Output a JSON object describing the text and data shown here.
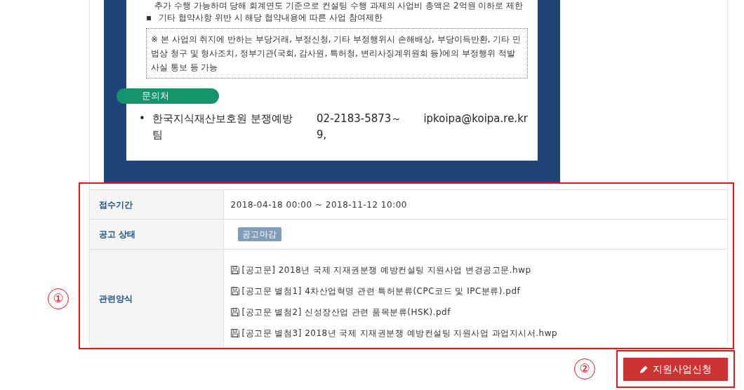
{
  "poster": {
    "items": [
      {
        "kind": "continuation",
        "text": "추가 수행 가능하며 당해 회계연도 기준으로 컨설팅 수행 과제의 사업비 총액은 2억원 이하로 제한"
      },
      {
        "kind": "bullet",
        "marker": "▪",
        "text": "기타 협약사항 위반 시 해당 협약내용에 따른 사업 참여제한"
      }
    ],
    "notice": "※ 본 사업의 취지에 반하는 부당거래, 부정신청, 기타 부정행위시 손해배상, 부당이득반환, 기타 민법상 청구 및 형사조치, 정부기관(국회, 감사원, 특허청, 변리사징계위원회 등)에의 부정행위 적발사실 통보 등 가능",
    "contact_heading": "문의처",
    "contact": {
      "marker": "•",
      "org": "한국지식재산보호원 분쟁예방팀",
      "phone": "02-2183-5873～9,",
      "email": "ipkoipa@koipa.re.kr"
    }
  },
  "table": {
    "annotation": "①",
    "rows": [
      {
        "label": "접수기간",
        "kind": "text",
        "value": "2018-04-18 00:00 ~ 2018-11-12 10:00"
      },
      {
        "label": "공고 상태",
        "kind": "badge",
        "value": "공고마감"
      },
      {
        "label": "관련양식",
        "kind": "files",
        "files": [
          "[공고문] 2018년 국제 지재권분쟁 예방컨설팅 지원사업 변경공고문.hwp",
          "[공고문 별첨1] 4차산업혁명 관련 특허분류(CPC코드 및 IPC분류).pdf",
          "[공고문 별첨2] 신성장산업 관련 품목분류(HSK).pdf",
          "[공고문 별첨3] 2018년 국제 지재권분쟁 예방컨설팅 지원사업 과업지시서.hwp"
        ]
      }
    ]
  },
  "apply_button": {
    "annotation": "②",
    "label": "지원사업신청"
  }
}
